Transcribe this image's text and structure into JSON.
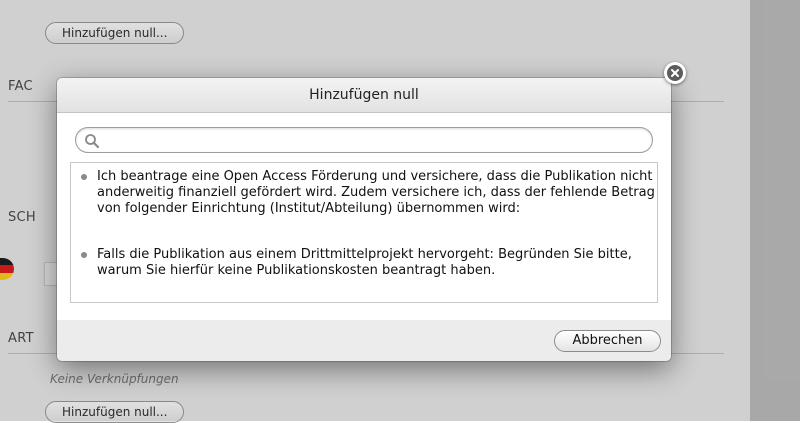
{
  "background": {
    "add_button_label": "Hinzufügen null...",
    "sections": {
      "fac": "FAC",
      "sch": "SCH",
      "art": "ART"
    },
    "no_links_text": "Keine Verknüpfungen"
  },
  "dialog": {
    "title": "Hinzufügen null",
    "search": {
      "value": "",
      "placeholder": ""
    },
    "items": [
      {
        "label": "Ich beantrage eine Open Access Förderung und versichere, dass die Publikation nicht anderweitig finanziell gefördert wird. Zudem versichere ich, dass der fehlende Betrag von folgender Einrichtung (Institut/Abteilung) übernommen wird:"
      },
      {
        "label": "Falls die Publikation aus einem Drittmittelprojekt hervorgeht: Begründen Sie bitte, warum Sie hierfür keine Publikationskosten beantragt haben."
      }
    ],
    "cancel_label": "Abbrechen"
  },
  "icons": {
    "search": "search-icon",
    "close": "close-icon",
    "flag": "german-flag-icon"
  },
  "colors": {
    "overlay": "#787878",
    "flag_black": "#000000",
    "flag_red": "#dd0000",
    "flag_gold": "#ffce00"
  }
}
